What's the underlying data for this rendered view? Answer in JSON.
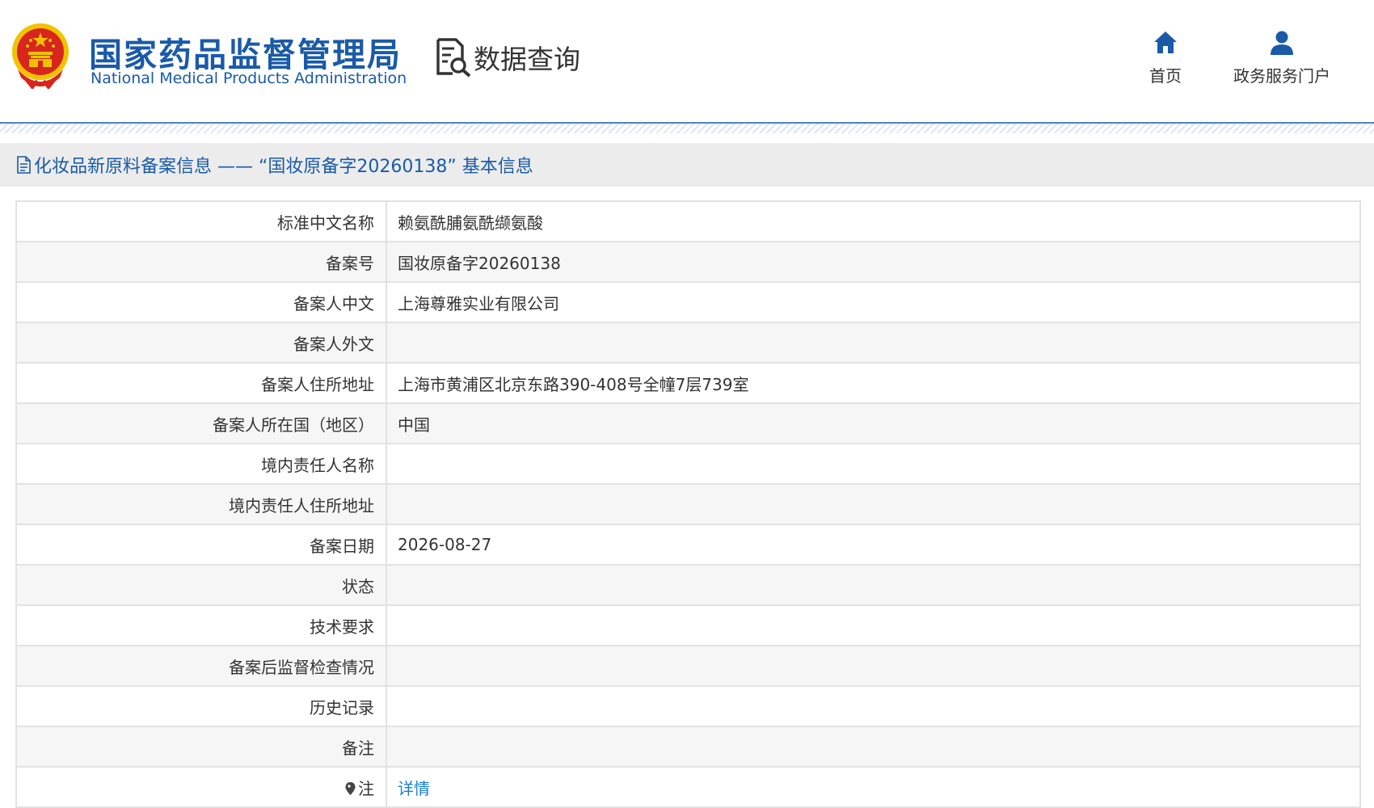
{
  "header": {
    "agency_name_cn": "国家药品监督管理局",
    "agency_name_en": "National Medical Products Administration",
    "section_title": "数据查询",
    "nav": {
      "home": "首页",
      "gov_portal": "政务服务门户"
    }
  },
  "page_title": "化妆品新原料备案信息 —— “国妆原备字20260138” 基本信息",
  "record": {
    "rows": [
      {
        "label": "标准中文名称",
        "value": "赖氨酰脯氨酰缬氨酸"
      },
      {
        "label": "备案号",
        "value": "国妆原备字20260138"
      },
      {
        "label": "备案人中文",
        "value": "上海尊雅实业有限公司"
      },
      {
        "label": "备案人外文",
        "value": ""
      },
      {
        "label": "备案人住所地址",
        "value": "上海市黄浦区北京东路390-408号全幢7层739室"
      },
      {
        "label": "备案人所在国（地区）",
        "value": "中国"
      },
      {
        "label": "境内责任人名称",
        "value": ""
      },
      {
        "label": "境内责任人住所地址",
        "value": ""
      },
      {
        "label": "备案日期",
        "value": "2026-08-27"
      },
      {
        "label": "状态",
        "value": ""
      },
      {
        "label": "技术要求",
        "value": ""
      },
      {
        "label": "备案后监督检查情况",
        "value": ""
      },
      {
        "label": "历史记录",
        "value": ""
      },
      {
        "label": "备注",
        "value": ""
      }
    ],
    "note": {
      "label": "注",
      "link_text": "详情"
    }
  },
  "colors": {
    "brand_blue": "#1a5aa8",
    "link_blue": "#1a7fd4",
    "emblem_red": "#d7261e",
    "emblem_gold": "#f2c200"
  }
}
